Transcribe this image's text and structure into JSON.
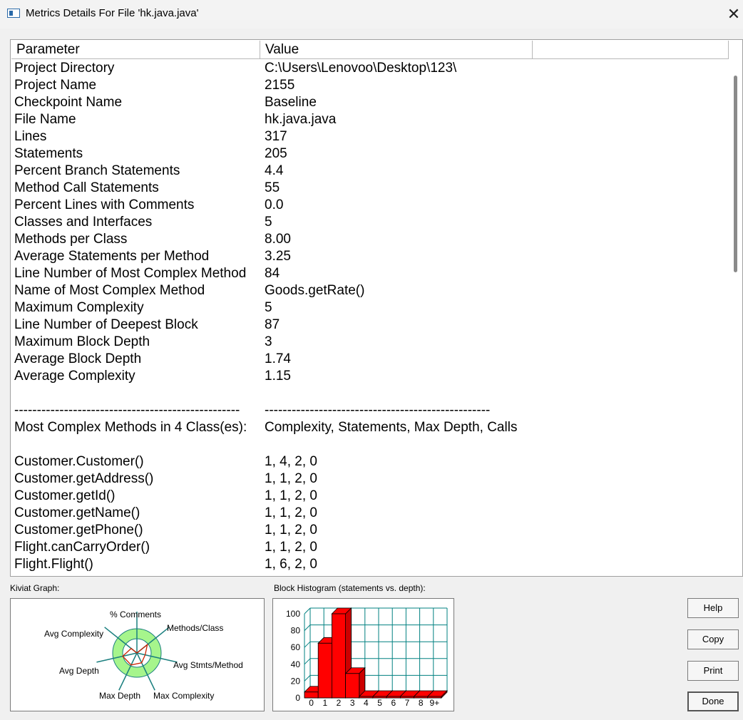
{
  "window": {
    "title": "Metrics Details For File 'hk.java.java'",
    "close_glyph": "✕"
  },
  "table": {
    "columns": [
      "Parameter",
      "Value"
    ],
    "rows": [
      {
        "k": "Project Directory",
        "v": "C:\\Users\\Lenovoo\\Desktop\\123\\"
      },
      {
        "k": "Project Name",
        "v": "2155"
      },
      {
        "k": "Checkpoint Name",
        "v": "Baseline"
      },
      {
        "k": "File Name",
        "v": "hk.java.java"
      },
      {
        "k": "Lines",
        "v": "317"
      },
      {
        "k": "Statements",
        "v": "205"
      },
      {
        "k": "Percent Branch Statements",
        "v": "4.4"
      },
      {
        "k": "Method Call Statements",
        "v": "55"
      },
      {
        "k": "Percent Lines with Comments",
        "v": "0.0"
      },
      {
        "k": "Classes and Interfaces",
        "v": "5"
      },
      {
        "k": "Methods per Class",
        "v": "8.00"
      },
      {
        "k": "Average Statements per Method",
        "v": "3.25"
      },
      {
        "k": "Line Number of Most Complex Method",
        "v": "84"
      },
      {
        "k": "Name of Most Complex Method",
        "v": "Goods.getRate()"
      },
      {
        "k": "Maximum Complexity",
        "v": "5"
      },
      {
        "k": "Line Number of Deepest Block",
        "v": "87"
      },
      {
        "k": "Maximum Block Depth",
        "v": "3"
      },
      {
        "k": "Average Block Depth",
        "v": "1.74"
      },
      {
        "k": "Average Complexity",
        "v": "1.15"
      },
      {
        "k": "",
        "v": ""
      },
      {
        "k": "--------------------------------------------------",
        "v": "--------------------------------------------------"
      },
      {
        "k": "Most Complex Methods in 4 Class(es):",
        "v": "Complexity, Statements, Max Depth, Calls"
      },
      {
        "k": "",
        "v": ""
      },
      {
        "k": "Customer.Customer()",
        "v": "1, 4, 2, 0"
      },
      {
        "k": "Customer.getAddress()",
        "v": "1, 1, 2, 0"
      },
      {
        "k": "Customer.getId()",
        "v": "1, 1, 2, 0"
      },
      {
        "k": "Customer.getName()",
        "v": "1, 1, 2, 0"
      },
      {
        "k": "Customer.getPhone()",
        "v": "1, 1, 2, 0"
      },
      {
        "k": "Flight.canCarryOrder()",
        "v": "1, 1, 2, 0"
      },
      {
        "k": "Flight.Flight()",
        "v": "1, 6, 2, 0"
      }
    ]
  },
  "kiviat": {
    "label": "Kiviat Graph:",
    "axes": [
      "% Comments",
      "Methods/Class",
      "Avg Stmts/Method",
      "Max Complexity",
      "Max Depth",
      "Avg Depth",
      "Avg Complexity"
    ],
    "values": [
      0.0,
      0.55,
      0.35,
      0.45,
      0.55,
      0.6,
      0.3
    ],
    "colors": {
      "band": "#a6f58c",
      "spoke": "#1a7f7f",
      "outline": "#cc2200"
    }
  },
  "histogram": {
    "label": "Block Histogram (statements vs. depth):",
    "categories": [
      "0",
      "1",
      "2",
      "3",
      "4",
      "5",
      "6",
      "7",
      "8",
      "9+"
    ],
    "values": [
      7,
      65,
      100,
      29,
      1,
      1,
      1,
      1,
      1,
      1
    ],
    "y_ticks": [
      "100",
      "80",
      "60",
      "40",
      "20",
      "0"
    ],
    "ylim": [
      0,
      100
    ],
    "colors": {
      "bar": "#ff0000",
      "grid": "#008080"
    }
  },
  "buttons": {
    "help": "Help",
    "copy": "Copy",
    "print": "Print",
    "done": "Done"
  }
}
